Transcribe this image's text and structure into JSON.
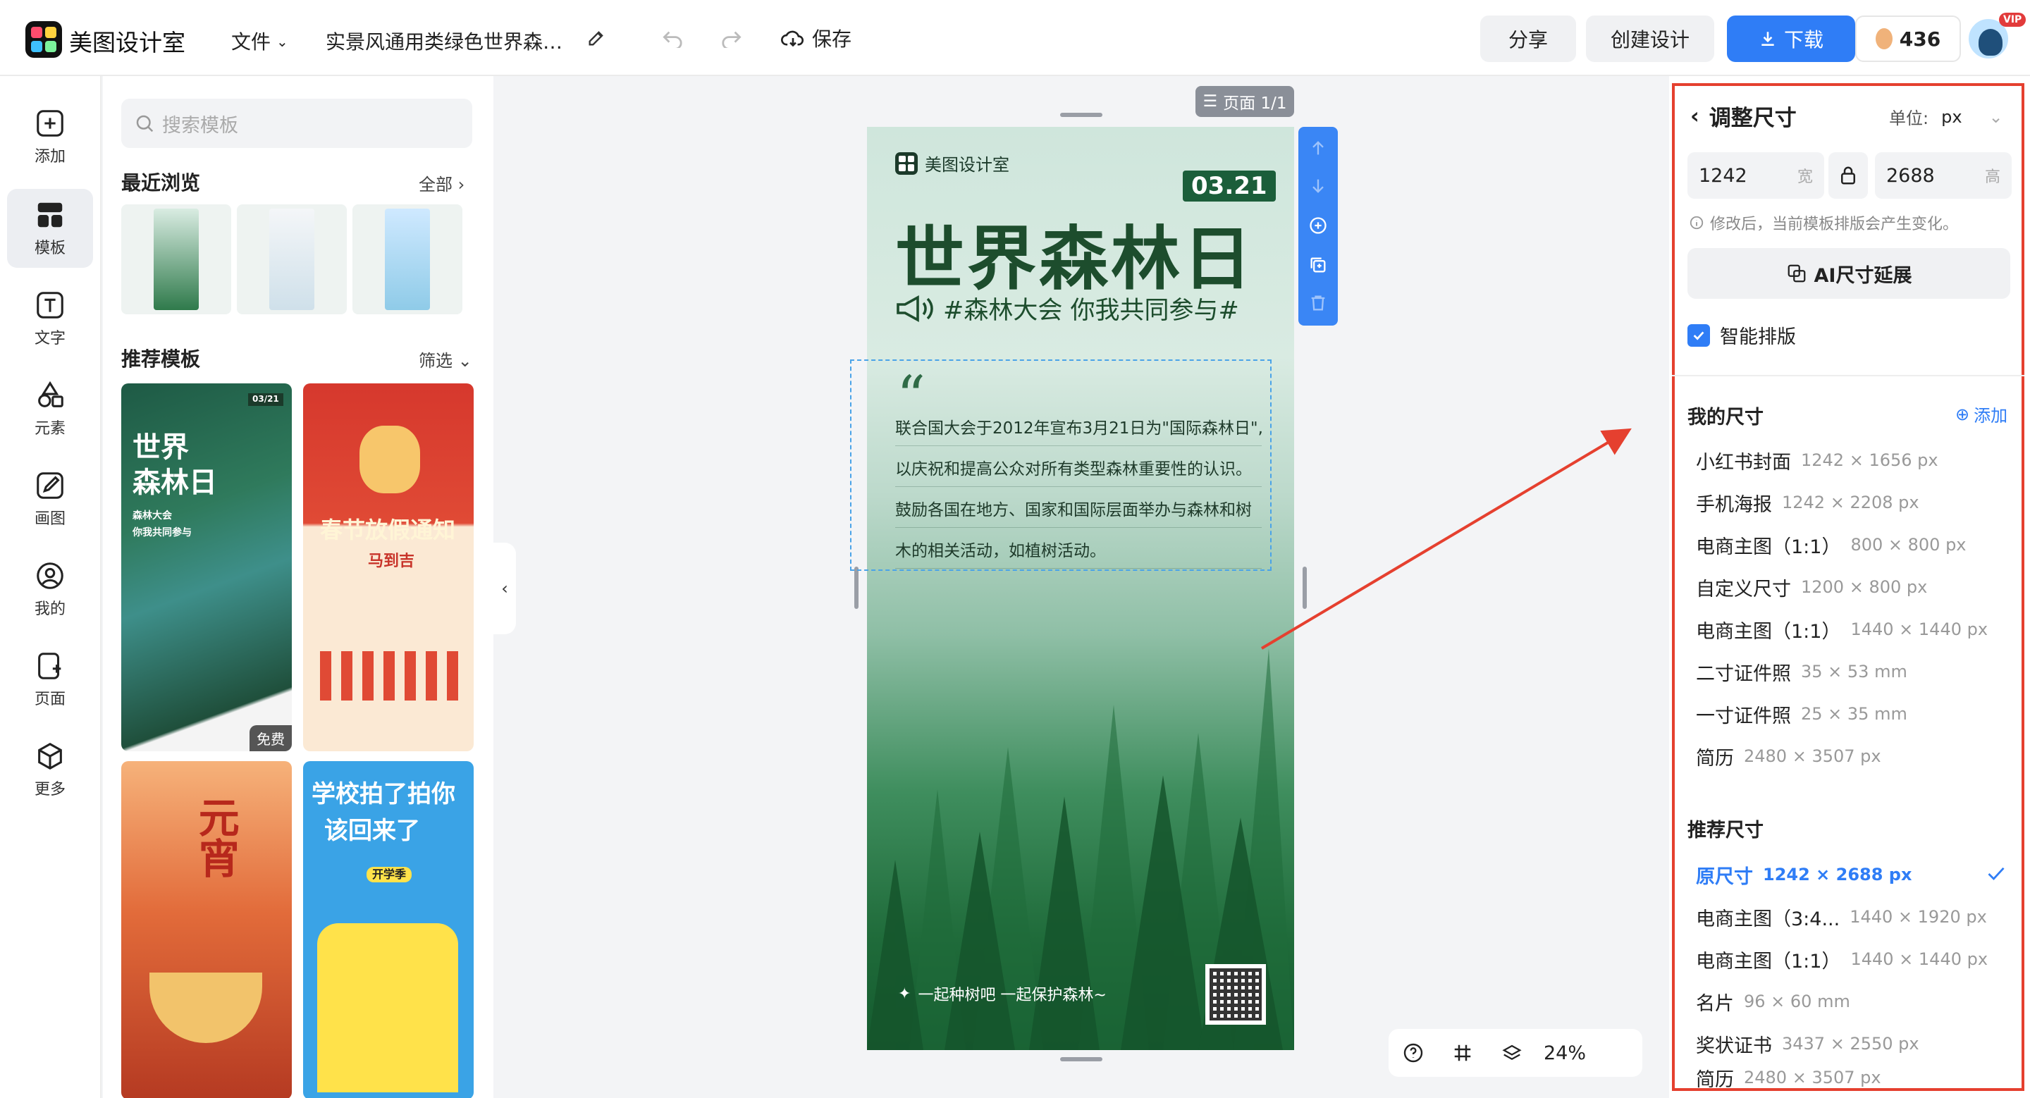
{
  "app": {
    "name": "美图设计室",
    "menu_file": "文件",
    "doc_title": "实景风通用类绿色世界森林...",
    "save_label": "保存",
    "share_label": "分享",
    "create_label": "创建设计",
    "download_label": "下载",
    "coins": "436",
    "vip": "VIP"
  },
  "rail": [
    {
      "label": "添加",
      "icon": "plus-square-icon"
    },
    {
      "label": "模板",
      "icon": "template-grid-icon",
      "active": true
    },
    {
      "label": "文字",
      "icon": "text-icon"
    },
    {
      "label": "元素",
      "icon": "shapes-icon"
    },
    {
      "label": "画图",
      "icon": "pen-icon"
    },
    {
      "label": "我的",
      "icon": "user-icon"
    },
    {
      "label": "页面",
      "icon": "page-add-icon"
    },
    {
      "label": "更多",
      "icon": "cube-icon"
    }
  ],
  "panel": {
    "search_placeholder": "搜索模板",
    "recent_title": "最近浏览",
    "recent_all": "全部",
    "recommend_title": "推荐模板",
    "filter_label": "筛选",
    "card1": {
      "title_line1": "世界",
      "title_line2": "森林日",
      "sub1": "森林大会",
      "sub2": "你我共同参与",
      "date": "03/21",
      "badge": "免费"
    },
    "card2": {
      "title": "春节放假通知",
      "seal": "马到吉"
    },
    "card3": {
      "title": "元宵"
    },
    "card4": {
      "title_line1": "学校拍了拍你",
      "title_line2": "该回来了",
      "tag": "开学季"
    }
  },
  "canvas": {
    "page_indicator": "页面 1/1",
    "brand": "美图设计室",
    "date": "03.21",
    "title": "世界森林日",
    "subtitle": "#森林大会 你我共同参与#",
    "quote_mark": "“",
    "quote_lines": [
      "联合国大会于2012年宣布3月21日为\"国际森林日\",",
      "以庆祝和提高公众对所有类型森林重要性的认识。",
      "鼓励各国在地方、国家和国际层面举办与森林和树",
      "木的相关活动，如植树活动。"
    ],
    "footer": "一起种树吧 一起保护森林~",
    "zoom": "24%"
  },
  "resize": {
    "title": "调整尺寸",
    "unit_label": "单位:",
    "unit_value": "px",
    "width": "1242",
    "width_label": "宽",
    "height": "2688",
    "height_label": "高",
    "hint": "修改后，当前模板排版会产生变化。",
    "ai_button": "AI尺寸延展",
    "smart_layout": "智能排版",
    "my_sizes_title": "我的尺寸",
    "add_label": "添加",
    "my_sizes": [
      {
        "name": "小红书封面",
        "dim": "1242 × 1656 px"
      },
      {
        "name": "手机海报",
        "dim": "1242 × 2208 px"
      },
      {
        "name": "电商主图（1:1）",
        "dim": "800 × 800 px"
      },
      {
        "name": "自定义尺寸",
        "dim": "1200 × 800 px"
      },
      {
        "name": "电商主图（1:1）",
        "dim": "1440 × 1440 px"
      },
      {
        "name": "二寸证件照",
        "dim": "35 × 53 mm"
      },
      {
        "name": "一寸证件照",
        "dim": "25 × 35 mm"
      },
      {
        "name": "简历",
        "dim": "2480 × 3507 px"
      }
    ],
    "recommended_title": "推荐尺寸",
    "recommended": [
      {
        "name": "原尺寸",
        "dim": "1242 × 2688 px",
        "selected": true
      },
      {
        "name": "电商主图（3:4...",
        "dim": "1440 × 1920 px"
      },
      {
        "name": "电商主图（1:1）",
        "dim": "1440 × 1440 px"
      },
      {
        "name": "名片",
        "dim": "96 × 60 mm"
      },
      {
        "name": "奖状证书",
        "dim": "3437 × 2550 px"
      },
      {
        "name": "简历",
        "dim": "2480 × 3507 px"
      }
    ]
  },
  "colors": {
    "accent": "#2f7df6",
    "highlight_frame": "#e5402f",
    "forest_dark": "#1d4d2d"
  }
}
